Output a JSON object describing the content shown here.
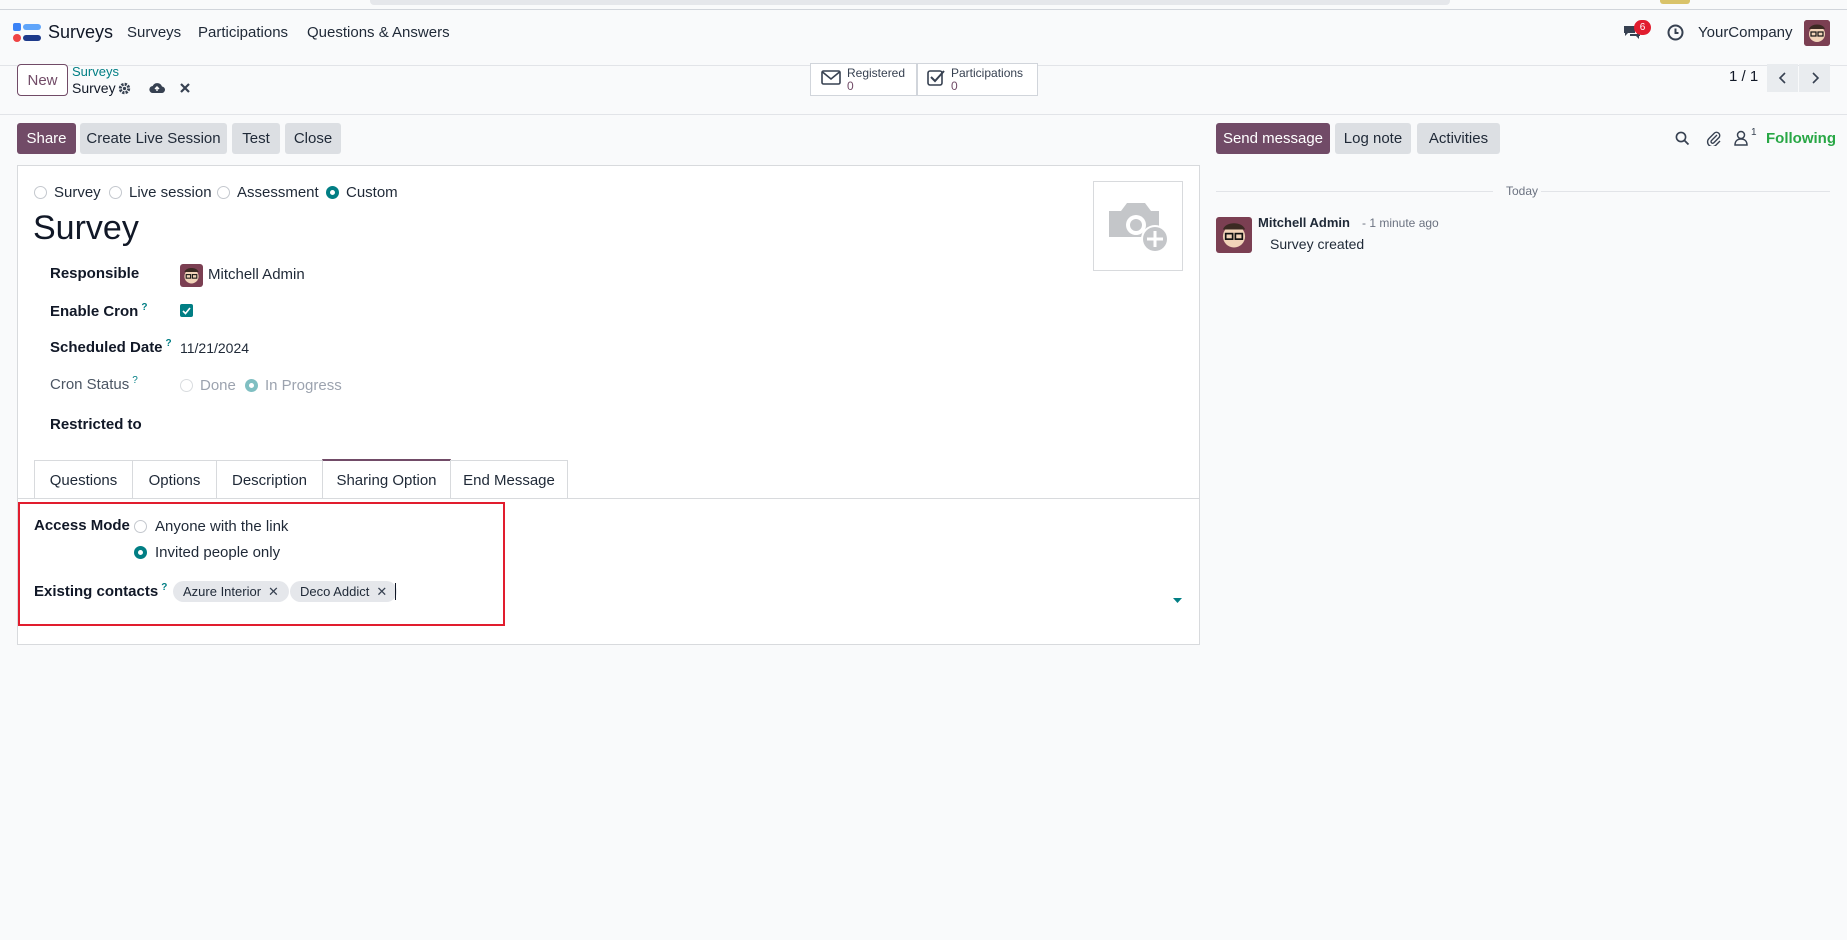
{
  "nav": {
    "brand": "Surveys",
    "menu": [
      "Surveys",
      "Participations",
      "Questions & Answers"
    ],
    "messages_count": "6",
    "company": "YourCompany"
  },
  "control": {
    "new_label": "New",
    "breadcrumb_parent": "Surveys",
    "breadcrumb_current": "Survey",
    "stats": [
      {
        "label": "Registered",
        "value": "0"
      },
      {
        "label": "Participations",
        "value": "0"
      }
    ],
    "pager": "1 / 1"
  },
  "statusbar": {
    "share": "Share",
    "create_live": "Create Live Session",
    "test": "Test",
    "close": "Close"
  },
  "form": {
    "types": [
      {
        "label": "Survey",
        "selected": false
      },
      {
        "label": "Live session",
        "selected": false
      },
      {
        "label": "Assessment",
        "selected": false
      },
      {
        "label": "Custom",
        "selected": true
      }
    ],
    "title": "Survey",
    "responsible_label": "Responsible",
    "responsible_value": "Mitchell Admin",
    "enable_cron_label": "Enable Cron",
    "enable_cron_value": true,
    "scheduled_date_label": "Scheduled Date",
    "scheduled_date_value": "11/21/2024",
    "cron_status_label": "Cron Status",
    "cron_status_options": [
      {
        "label": "Done",
        "selected": false
      },
      {
        "label": "In Progress",
        "selected": true
      }
    ],
    "restricted_label": "Restricted to",
    "help_mark": "?"
  },
  "tabs": [
    {
      "label": "Questions",
      "active": false
    },
    {
      "label": "Options",
      "active": false
    },
    {
      "label": "Description",
      "active": false
    },
    {
      "label": "Sharing Option",
      "active": true
    },
    {
      "label": "End Message",
      "active": false
    }
  ],
  "sharing": {
    "access_mode_label": "Access Mode",
    "access_options": [
      {
        "label": "Anyone with the link",
        "selected": false
      },
      {
        "label": "Invited people only",
        "selected": true
      }
    ],
    "contacts_label": "Existing contacts",
    "contacts": [
      "Azure Interior",
      "Deco Addict"
    ]
  },
  "chatter": {
    "send_message": "Send message",
    "log_note": "Log note",
    "activities": "Activities",
    "followers_count": "1",
    "following": "Following",
    "day_separator": "Today",
    "message_author": "Mitchell Admin",
    "message_time": "- 1 minute ago",
    "message_body": "Survey created"
  },
  "colors": {
    "primary": "#714b67",
    "accent": "#017e84",
    "highlight_box": "#e11d2e",
    "badge": "#e11d2e",
    "following": "#28a745"
  }
}
